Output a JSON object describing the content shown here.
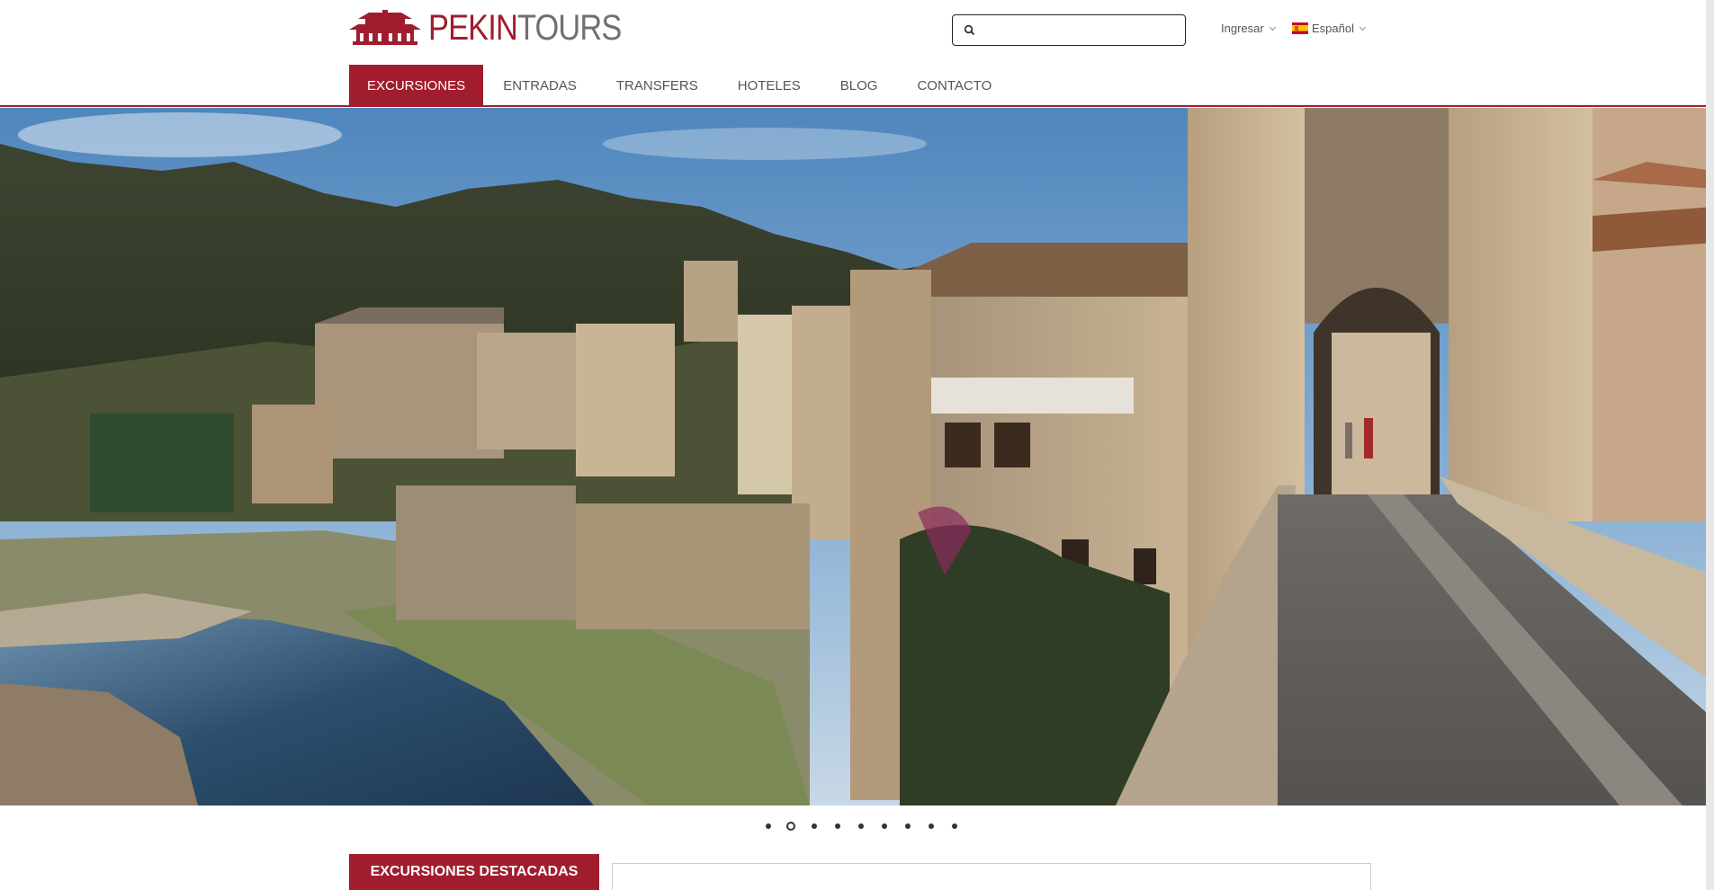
{
  "brand": {
    "part1": "PEKIN",
    "part2": "TOURS",
    "color": "#a11d2e"
  },
  "search": {
    "placeholder": "",
    "value": ""
  },
  "header": {
    "login_label": "Ingresar",
    "language_label": "Español"
  },
  "nav": {
    "items": [
      {
        "label": "EXCURSIONES",
        "active": true
      },
      {
        "label": "ENTRADAS",
        "active": false
      },
      {
        "label": "TRANSFERS",
        "active": false
      },
      {
        "label": "HOTELES",
        "active": false
      },
      {
        "label": "BLOG",
        "active": false
      },
      {
        "label": "CONTACTO",
        "active": false
      }
    ]
  },
  "slider": {
    "slide_count": 9,
    "active_index": 1
  },
  "featured": {
    "tab_label": "EXCURSIONES DESTACADAS",
    "box_text": ""
  },
  "colors": {
    "accent": "#a11d2e",
    "text": "#555555"
  }
}
